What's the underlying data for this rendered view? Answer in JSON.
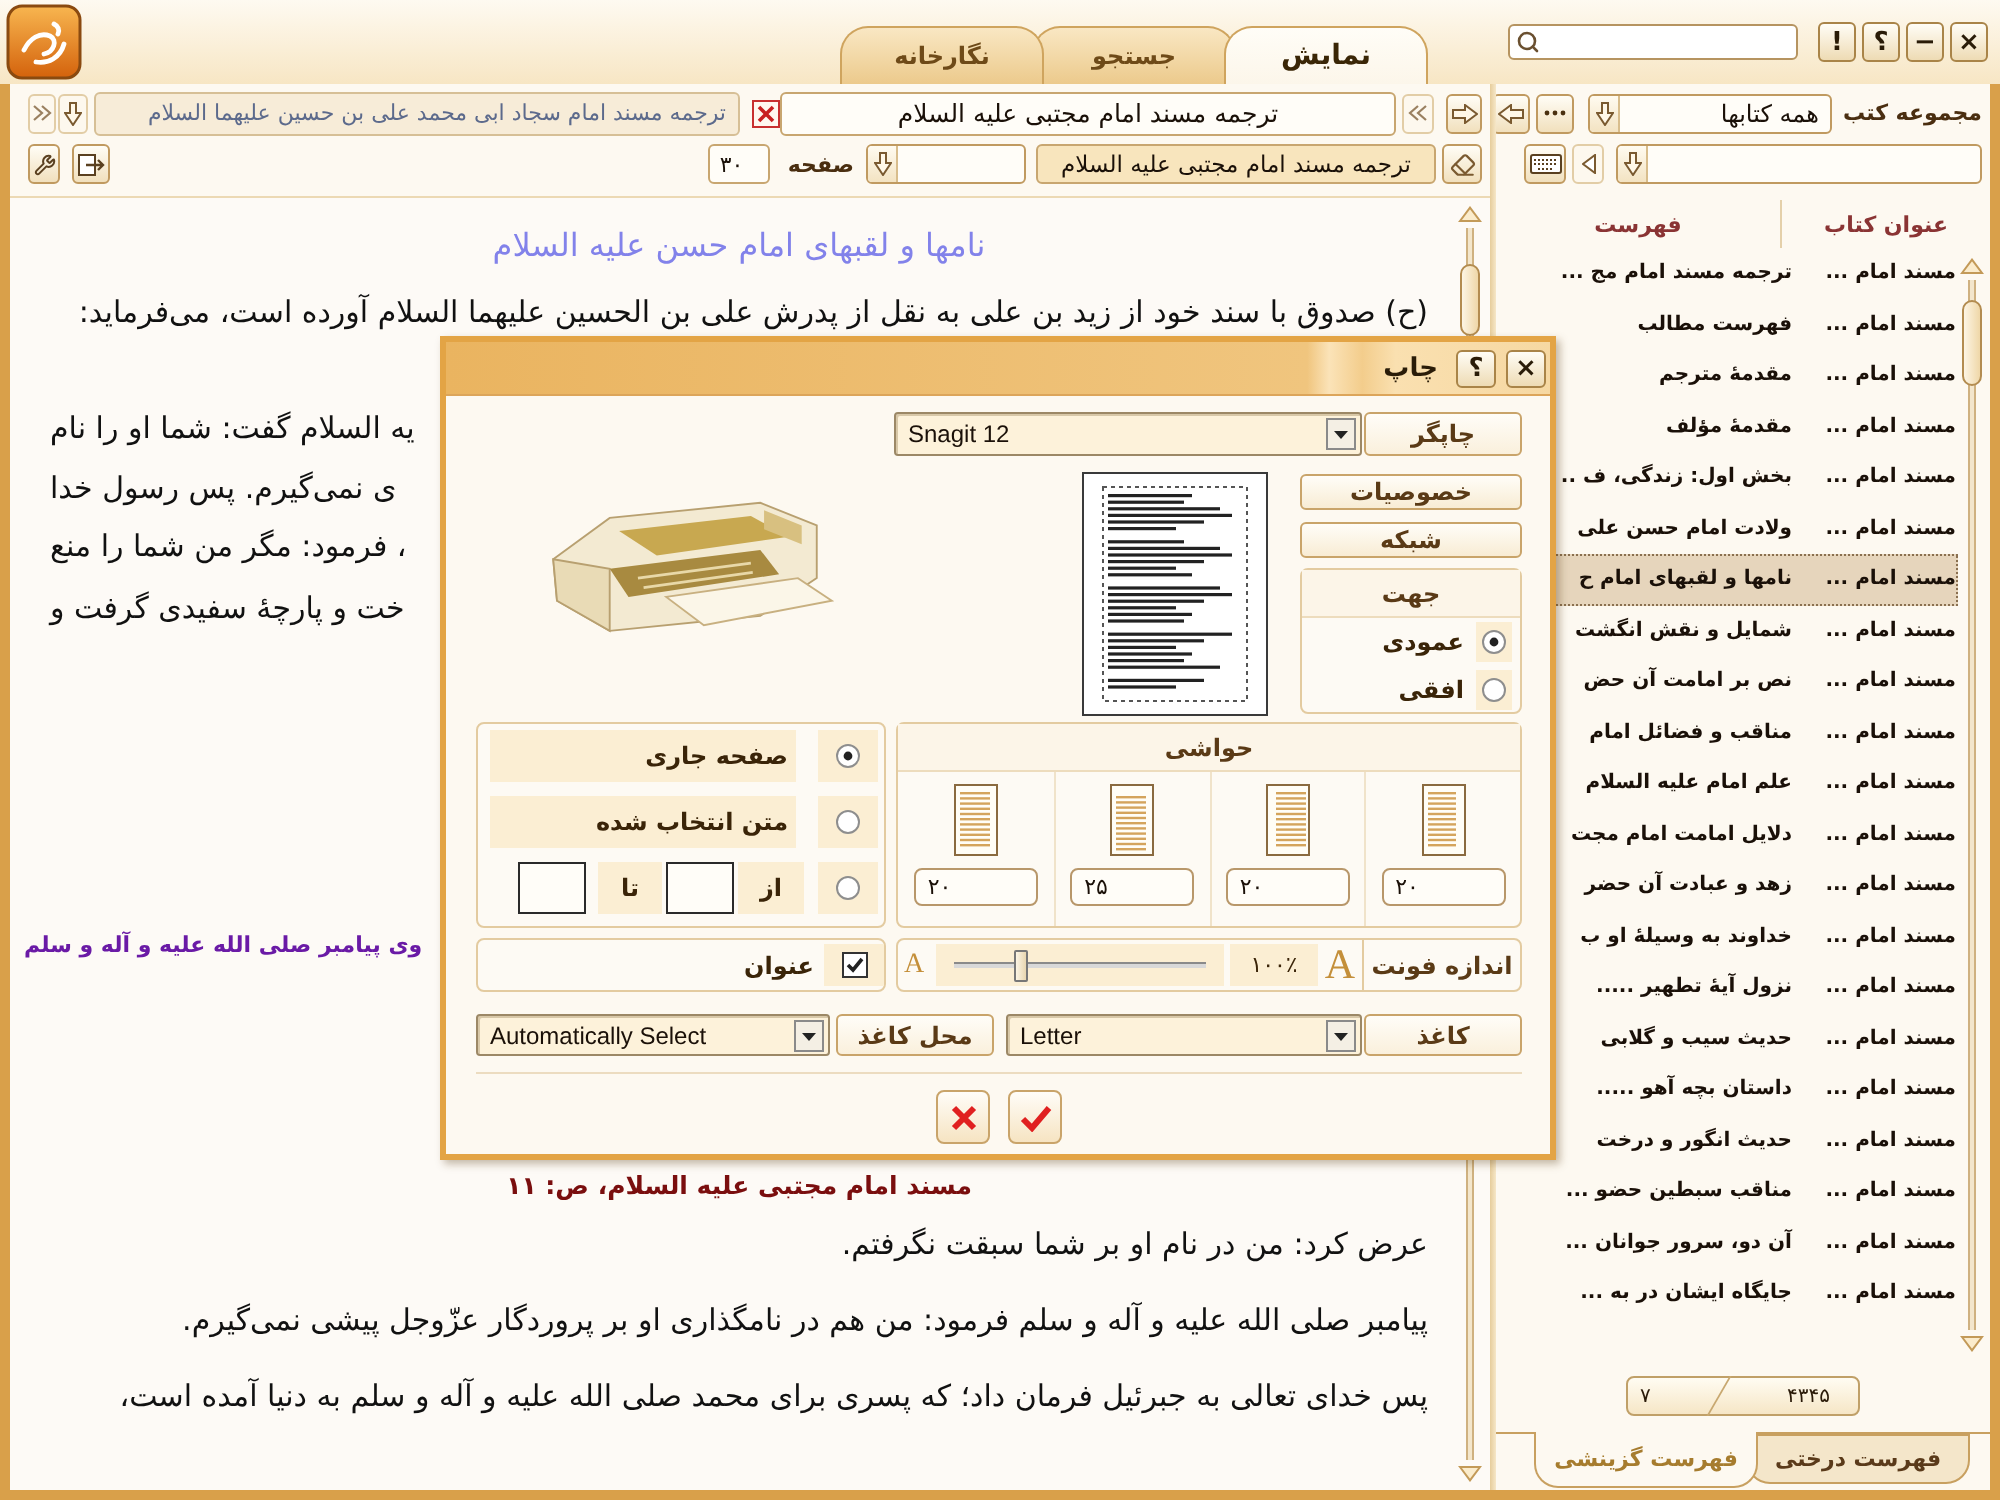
{
  "window_buttons": [
    "×",
    "−",
    "؟",
    "!"
  ],
  "tabs": [
    {
      "label": "نمایش",
      "selected": true
    },
    {
      "label": "جستجو",
      "selected": false
    },
    {
      "label": "نگارخانه",
      "selected": false
    }
  ],
  "collection": {
    "label": "مجموعه کتب",
    "value": "همه کتابها"
  },
  "book_list": {
    "columns": [
      "عنوان کتاب",
      "فهرست"
    ],
    "rows": [
      {
        "book": "مسند امام ...",
        "title": "ترجمه مسند امام مج ...",
        "selected": false
      },
      {
        "book": "مسند امام ...",
        "title": "فهرست مطالب",
        "selected": false
      },
      {
        "book": "مسند امام ...",
        "title": "مقدمهٔ مترجم",
        "selected": false
      },
      {
        "book": "مسند امام ...",
        "title": "مقدمهٔ مؤلف",
        "selected": false
      },
      {
        "book": "مسند امام ...",
        "title": "بخش اول: زندگی، ف ..",
        "selected": false
      },
      {
        "book": "مسند امام ...",
        "title": "ولادت امام حسن علی",
        "selected": false
      },
      {
        "book": "مسند امام ...",
        "title": "نامها و لقبهای امام ح",
        "selected": true
      },
      {
        "book": "مسند امام ...",
        "title": "شمایل و نقش انگشت",
        "selected": false
      },
      {
        "book": "مسند امام ...",
        "title": "نص بر امامت آن حض",
        "selected": false
      },
      {
        "book": "مسند امام ...",
        "title": "مناقب و فضائل امام",
        "selected": false
      },
      {
        "book": "مسند امام ...",
        "title": "علم امام علیه السلام",
        "selected": false
      },
      {
        "book": "مسند امام ...",
        "title": "دلایل امامت امام مجت",
        "selected": false
      },
      {
        "book": "مسند امام ...",
        "title": "زهد و عبادت آن حضر",
        "selected": false
      },
      {
        "book": "مسند امام ...",
        "title": "خداوند به وسیلهٔ او ب",
        "selected": false
      },
      {
        "book": "مسند امام ...",
        "title": "نزول آیهٔ تطهیر .....",
        "selected": false
      },
      {
        "book": "مسند امام ...",
        "title": "حدیث سیب و گلابی",
        "selected": false
      },
      {
        "book": "مسند امام ...",
        "title": "داستان بچه آهو .....",
        "selected": false
      },
      {
        "book": "مسند امام ...",
        "title": "حدیث انگور و درخت",
        "selected": false
      },
      {
        "book": "مسند امام ...",
        "title": "مناقب سبطین حضو ...",
        "selected": false
      },
      {
        "book": "مسند امام ...",
        "title": "آن دو، سرور جوانان ...",
        "selected": false
      },
      {
        "book": "مسند امام ...",
        "title": "جایگاه ایشان در به ...",
        "selected": false
      }
    ]
  },
  "page_counter": [
    "۴۳۴۵",
    "۷"
  ],
  "bottom_tabs": [
    {
      "label": "فهرست درختی",
      "selected": false
    },
    {
      "label": "فهرست گزینشی",
      "selected": true
    }
  ],
  "open_books": [
    {
      "title": "ترجمه مسند امام مجتبی علیه السلام",
      "selected": true
    },
    {
      "title": "ترجمه مسند امام سجاد ابی محمد علی بن حسین علیهما السلام",
      "selected": false
    }
  ],
  "page_bar": {
    "book": "ترجمه مسند امام مجتبی علیه السلام",
    "page_label": "صفحه",
    "page": "۳۰"
  },
  "document": {
    "heading": "نامها و لقبهای امام حسن علیه السلام",
    "lines": [
      {
        "kind": "text",
        "text": "(ح) صدوق با سند خود از زید بن علی به نقل از پدرش علی بن الحسین علیهما السلام آورده است، می‌فرماید:"
      },
      {
        "kind": "fragment",
        "text": "یه السلام گفت: شما او را نام"
      },
      {
        "kind": "fragment",
        "text": "ی نمی‌گیرم. پس رسول خدا"
      },
      {
        "kind": "fragment",
        "text": "، فرمود: مگر من شما را منع"
      },
      {
        "kind": "fragment",
        "text": "خت و پارچهٔ سفیدی گرفت و"
      },
      {
        "kind": "citation",
        "text": "وی پیامبر صلی الله علیه و آله و سلم"
      },
      {
        "kind": "page_ref",
        "text": "مسند امام مجتبی علیه السلام، ص: ۱۱"
      },
      {
        "kind": "text",
        "text": "عرض کرد: من در نام او بر شما سبقت نگرفتم."
      },
      {
        "kind": "text",
        "text": "پیامبر صلی الله علیه و آله و سلم فرمود: من هم در نامگذاری او بر پروردگار عزّوجل پیشی نمی‌گیرم."
      },
      {
        "kind": "text",
        "text": "پس خدای تعالی به جبرئیل فرمان داد؛ که پسری برای محمد صلی الله علیه و آله و سلم به دنیا آمده است،"
      }
    ]
  },
  "print_dialog": {
    "title": "چاپ",
    "window_buttons": [
      "×",
      "؟"
    ],
    "printer": {
      "label": "چاپگر",
      "value": "Snagit 12"
    },
    "buttons": [
      "خصوصیات",
      "شبکه"
    ],
    "orientation": {
      "label": "جهت",
      "options": [
        {
          "label": "عمودی",
          "selected": true
        },
        {
          "label": "افقی",
          "selected": false
        }
      ]
    },
    "margins": {
      "label": "حواشی",
      "values": [
        "۲۰",
        "۲۰",
        "۲۵",
        "۲۰"
      ]
    },
    "range": {
      "options": [
        {
          "kind": "label",
          "label": "صفحه جاری",
          "selected": true
        },
        {
          "kind": "label",
          "label": "متن انتخاب شده",
          "selected": false
        },
        {
          "kind": "pages",
          "from_label": "از",
          "to_label": "تا",
          "selected": false
        }
      ]
    },
    "font_size": {
      "label": "اندازه فونت",
      "large_glyph": "A",
      "reading": "۱۰۰٪",
      "level": 0.25,
      "small_glyph": "A"
    },
    "title_option": {
      "label": "عنوان",
      "checked": true
    },
    "paper": {
      "label": "کاغذ",
      "value": "Letter"
    },
    "paper_source": {
      "label": "محل کاغذ",
      "value": "Automatically Select"
    }
  }
}
